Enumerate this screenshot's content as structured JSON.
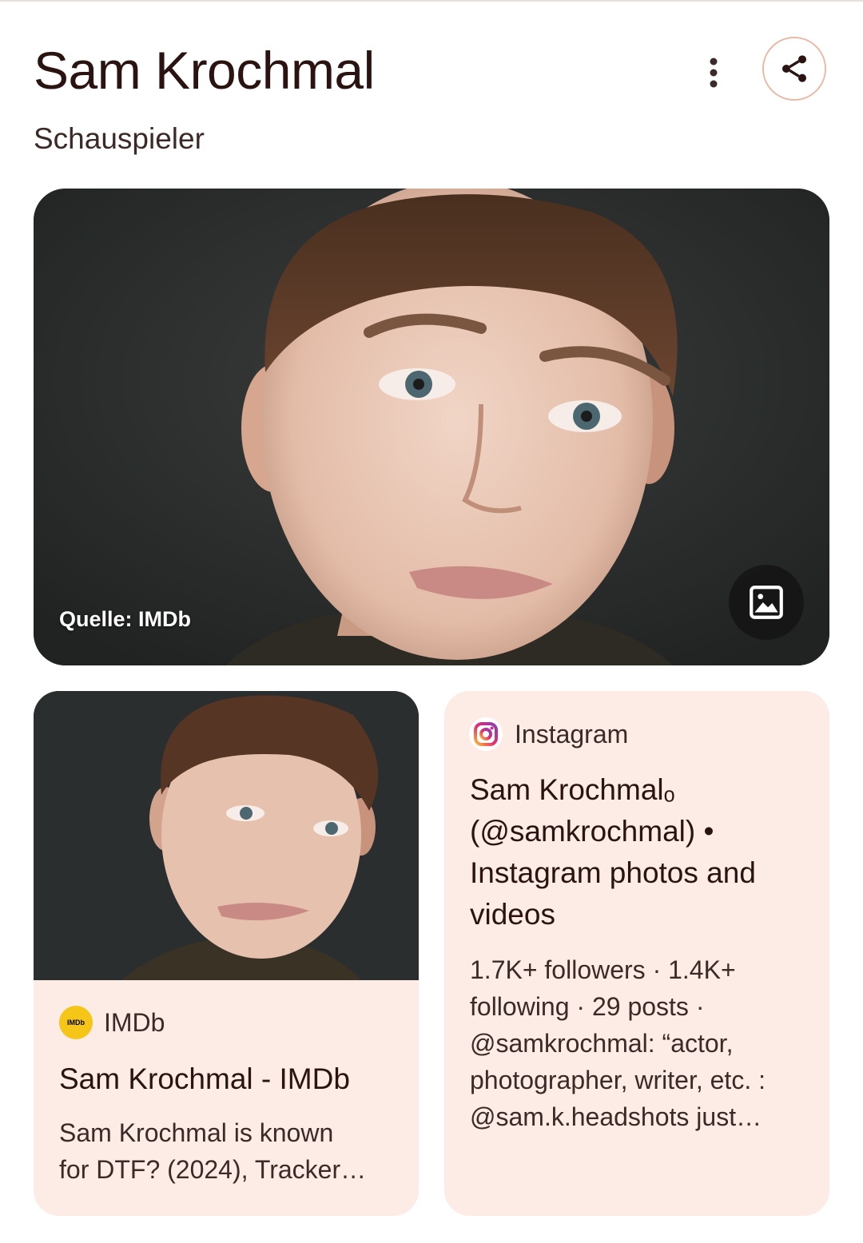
{
  "header": {
    "title": "Sam Krochmal",
    "subtitle": "Schauspieler",
    "more_icon": "more-vert-icon",
    "share_icon": "share-icon"
  },
  "hero": {
    "source_label": "Quelle: IMDb",
    "gallery_icon": "image-icon"
  },
  "cards": {
    "imdb": {
      "source": "IMDb",
      "logo_text": "IMDb",
      "title": "Sam Krochmal - IMDb",
      "description_line1": "Sam Krochmal is known",
      "description_line2": "for DTF? (2024), Tracker…"
    },
    "instagram": {
      "source": "Instagram",
      "title_line1": "Sam Krochmalₒ",
      "title_line2": "(@samkrochmal) •",
      "title_line3": "Instagram photos and",
      "title_line4": "videos",
      "description_line1": "1.7K+ followers · 1.4K+",
      "description_line2": "following · 29 posts ·",
      "description_line3": "@samkrochmal: “actor,",
      "description_line4": "photographer, writer, etc. :",
      "description_line5": "@sam.k.headshots just…"
    }
  },
  "colors": {
    "card_bg": "#fdebe5",
    "share_border": "#e9b9a6",
    "text_dark": "#2a1310",
    "imdb_yellow": "#f5c518"
  }
}
